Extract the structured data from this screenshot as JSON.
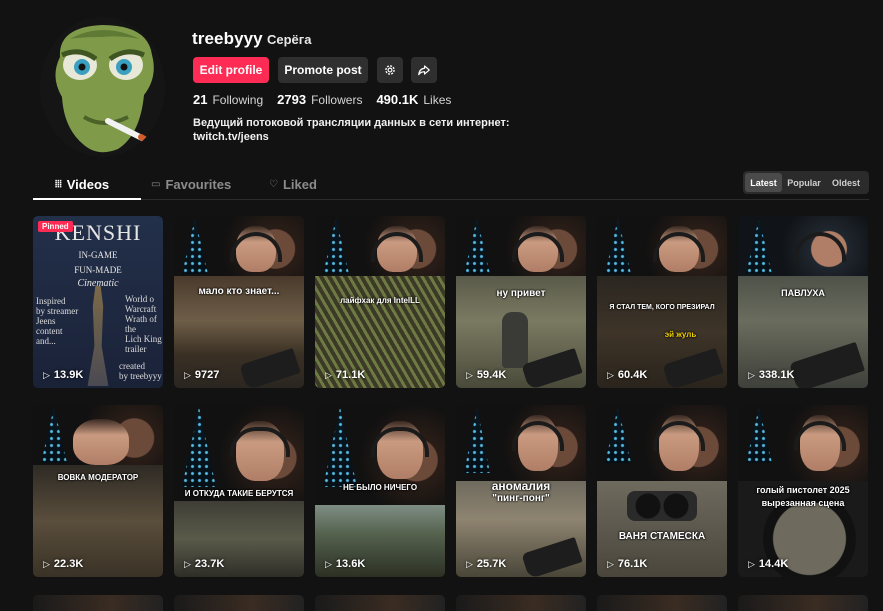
{
  "profile": {
    "username": "treebyyy",
    "nickname": "Серёга",
    "edit_label": "Edit profile",
    "promote_label": "Promote post",
    "stats": [
      {
        "value": "21",
        "label": "Following"
      },
      {
        "value": "2793",
        "label": "Followers"
      },
      {
        "value": "490.1K",
        "label": "Likes"
      }
    ],
    "bio_line1": "Ведущий потоковой трансляции данных в сети интернет:",
    "bio_line2": "twitch.tv/jeens"
  },
  "tabs": {
    "videos": "Videos",
    "favourites": "Favourites",
    "liked": "Liked"
  },
  "sort": {
    "latest": "Latest",
    "popular": "Popular",
    "oldest": "Oldest"
  },
  "colors": {
    "accent": "#fe2c55",
    "background": "#121212",
    "button": "#2f2f2f"
  },
  "videos": [
    {
      "pinned": "Pinned",
      "title": "KENSHI",
      "sub1": "IN-GAME",
      "sub2": "FUN-MADE",
      "sub3": "Cinematic",
      "left_text": [
        "Inspired",
        "by streamer",
        "Jeens",
        "content",
        "and..."
      ],
      "right_text": [
        "World o",
        "Warcraft",
        "Wrath of",
        "the",
        "Lich King",
        "trailer"
      ],
      "credit": [
        "created",
        "by treebyyy"
      ],
      "views": "13.9K"
    },
    {
      "caption": "мало кто знает...",
      "views": "9727"
    },
    {
      "caption": "лайфхак для IntelLL",
      "views": "71.1K"
    },
    {
      "caption": "ну привет",
      "views": "59.4K"
    },
    {
      "caption": "Я СТАЛ ТЕМ, КОГО ПРЕЗИРАЛ",
      "caption2": "эй жуль",
      "views": "60.4K"
    },
    {
      "caption": "ПАВЛУХА",
      "views": "338.1K"
    },
    {
      "caption": "ВОВКА МОДЕРАТОР",
      "views": "22.3K"
    },
    {
      "caption": "И ОТКУДА ТАКИЕ БЕРУТСЯ",
      "views": "23.7K"
    },
    {
      "caption": "НЕ БЫЛО НИЧЕГО",
      "views": "13.6K"
    },
    {
      "caption": "аномалия",
      "caption2": "\"пинг-понг\"",
      "views": "25.7K"
    },
    {
      "caption": "ВАНЯ СТАМЕСКА",
      "views": "76.1K"
    },
    {
      "caption": "голый пистолет 2025",
      "caption2": "вырезанная сцена",
      "views": "14.4K"
    }
  ]
}
